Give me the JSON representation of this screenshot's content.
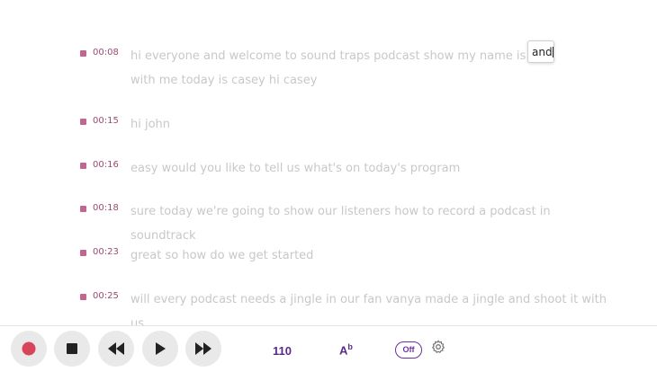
{
  "transcript": {
    "entries": [
      {
        "time": "00:08",
        "text": "hi everyone and welcome to sound traps podcast show my name is john",
        "text_after_edit": "with me today is casey hi casey"
      },
      {
        "time": "00:15",
        "text": "hi john"
      },
      {
        "time": "00:16",
        "text": "easy would you like to tell us what's on today's program"
      },
      {
        "time": "00:18",
        "text": "sure today we're going to show our listeners how to record a podcast in soundtrack"
      },
      {
        "time": "00:23",
        "text": "great so how do we get started"
      },
      {
        "time": "00:25",
        "text": "will every podcast needs a jingle in our fan vanya made a jingle and shoot it with us"
      }
    ],
    "edit_value": "and"
  },
  "toolbar": {
    "record_icon": "record-icon",
    "stop_icon": "stop-icon",
    "rewind_icon": "rewind-icon",
    "play_icon": "play-icon",
    "forward_icon": "fast-forward-icon",
    "tempo": "110",
    "font_label": "A",
    "font_sup": "b",
    "toggle_label": "Off",
    "settings_icon": "gear-icon"
  },
  "colors": {
    "accent": "#6a2fa0",
    "marker": "#c2668d",
    "record": "#d9445a"
  }
}
